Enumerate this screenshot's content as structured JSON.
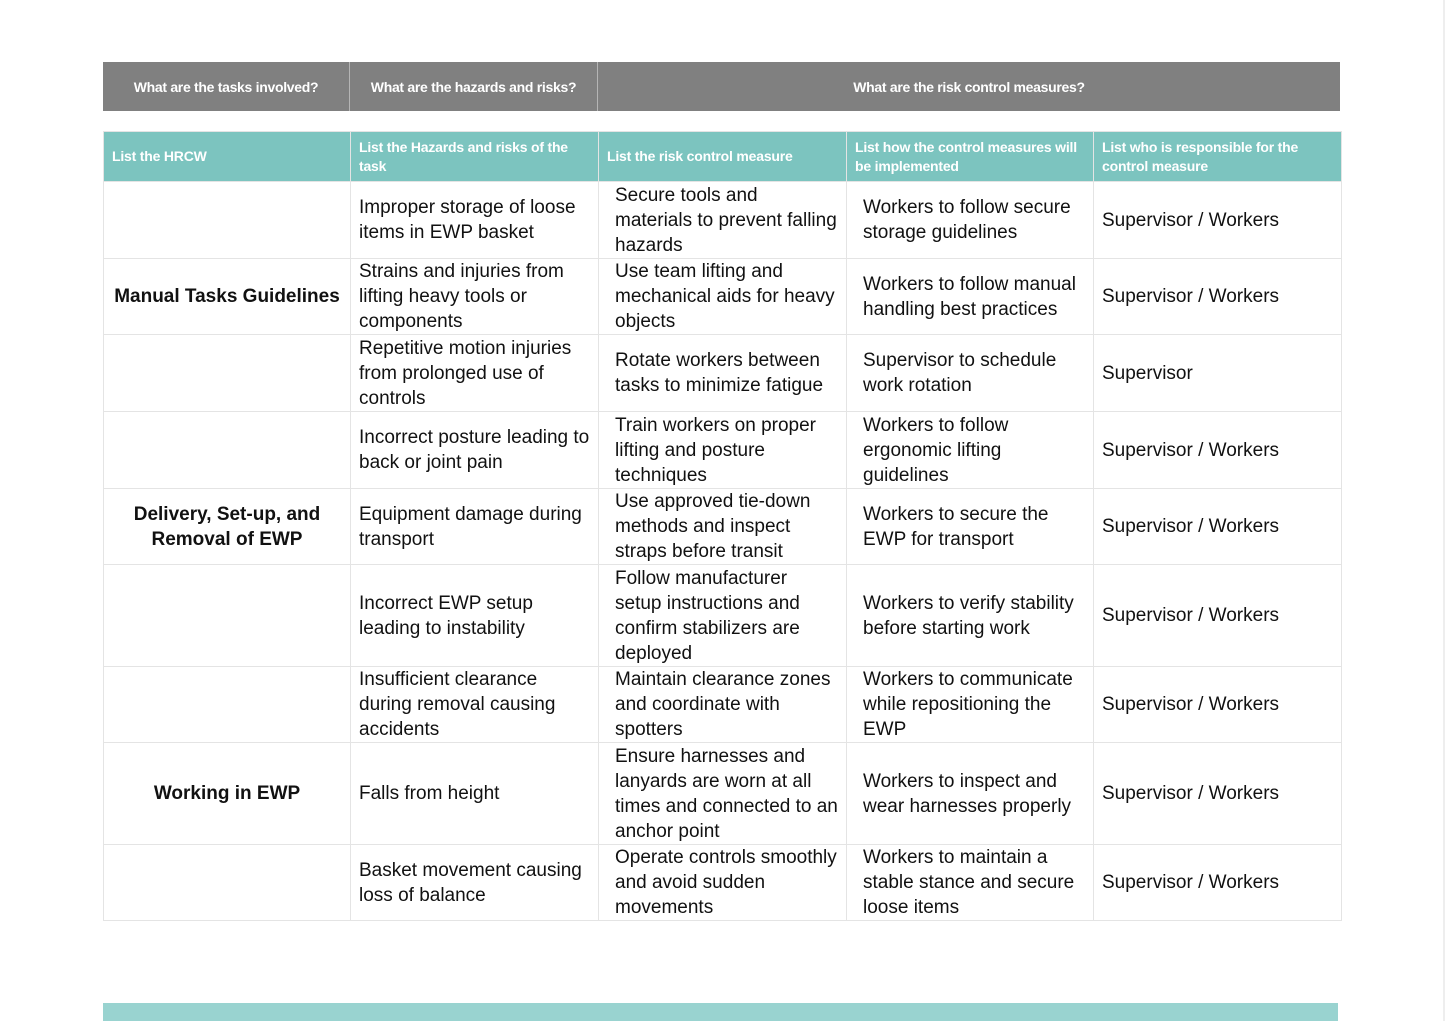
{
  "top_header": [
    "What are the tasks involved?",
    "What are the hazards and risks?",
    "What are the risk control measures?"
  ],
  "columns": [
    "List the HRCW",
    "List the Hazards and risks of the task",
    "List the risk control measure",
    "List how the control measures will be implemented",
    "List who is responsible for the control measure"
  ],
  "rows": [
    {
      "task": "",
      "hazard": "Improper storage of loose items in EWP basket",
      "control": "Secure tools and materials to prevent falling hazards",
      "implementation": "Workers to follow secure storage guidelines",
      "responsible": "Supervisor / Workers"
    },
    {
      "task": "Manual Tasks Guidelines",
      "hazard": "Strains and injuries from lifting heavy tools or components",
      "control": "Use team lifting and mechanical aids for heavy objects",
      "implementation": "Workers to follow manual handling best practices",
      "responsible": "Supervisor / Workers"
    },
    {
      "task": "",
      "hazard": "Repetitive motion injuries from prolonged use of controls",
      "control": "Rotate workers between tasks to minimize fatigue",
      "implementation": "Supervisor to schedule work rotation",
      "responsible": "Supervisor"
    },
    {
      "task": "",
      "hazard": "Incorrect posture leading to back or joint pain",
      "control": "Train workers on proper lifting and posture techniques",
      "implementation": "Workers to follow ergonomic lifting guidelines",
      "responsible": "Supervisor / Workers"
    },
    {
      "task": "Delivery, Set-up, and Removal of EWP",
      "hazard": "Equipment damage during transport",
      "control": "Use approved tie-down methods and inspect straps before transit",
      "implementation": "Workers to secure the EWP for transport",
      "responsible": "Supervisor / Workers"
    },
    {
      "task": "",
      "hazard": "Incorrect EWP setup leading to instability",
      "control": "Follow manufacturer setup instructions and confirm stabilizers are deployed",
      "implementation": "Workers to verify stability before starting work",
      "responsible": "Supervisor / Workers"
    },
    {
      "task": "",
      "hazard": "Insufficient clearance during removal causing accidents",
      "control": "Maintain clearance zones and coordinate with spotters",
      "implementation": "Workers to communicate while repositioning the EWP",
      "responsible": "Supervisor / Workers"
    },
    {
      "task": "Working in EWP",
      "hazard": "Falls from height",
      "control": "Ensure harnesses and lanyards are worn at all times and connected to an anchor point",
      "implementation": "Workers to inspect and wear harnesses properly",
      "responsible": "Supervisor / Workers"
    },
    {
      "task": "",
      "hazard": "Basket movement causing loss of balance",
      "control": "Operate controls smoothly and avoid sudden movements",
      "implementation": "Workers to maintain a stable stance and secure loose items",
      "responsible": "Supervisor / Workers"
    }
  ],
  "colors": {
    "top_header": "#808080",
    "column_header": "#7cc4bf",
    "footer_band": "#99d3d0"
  }
}
